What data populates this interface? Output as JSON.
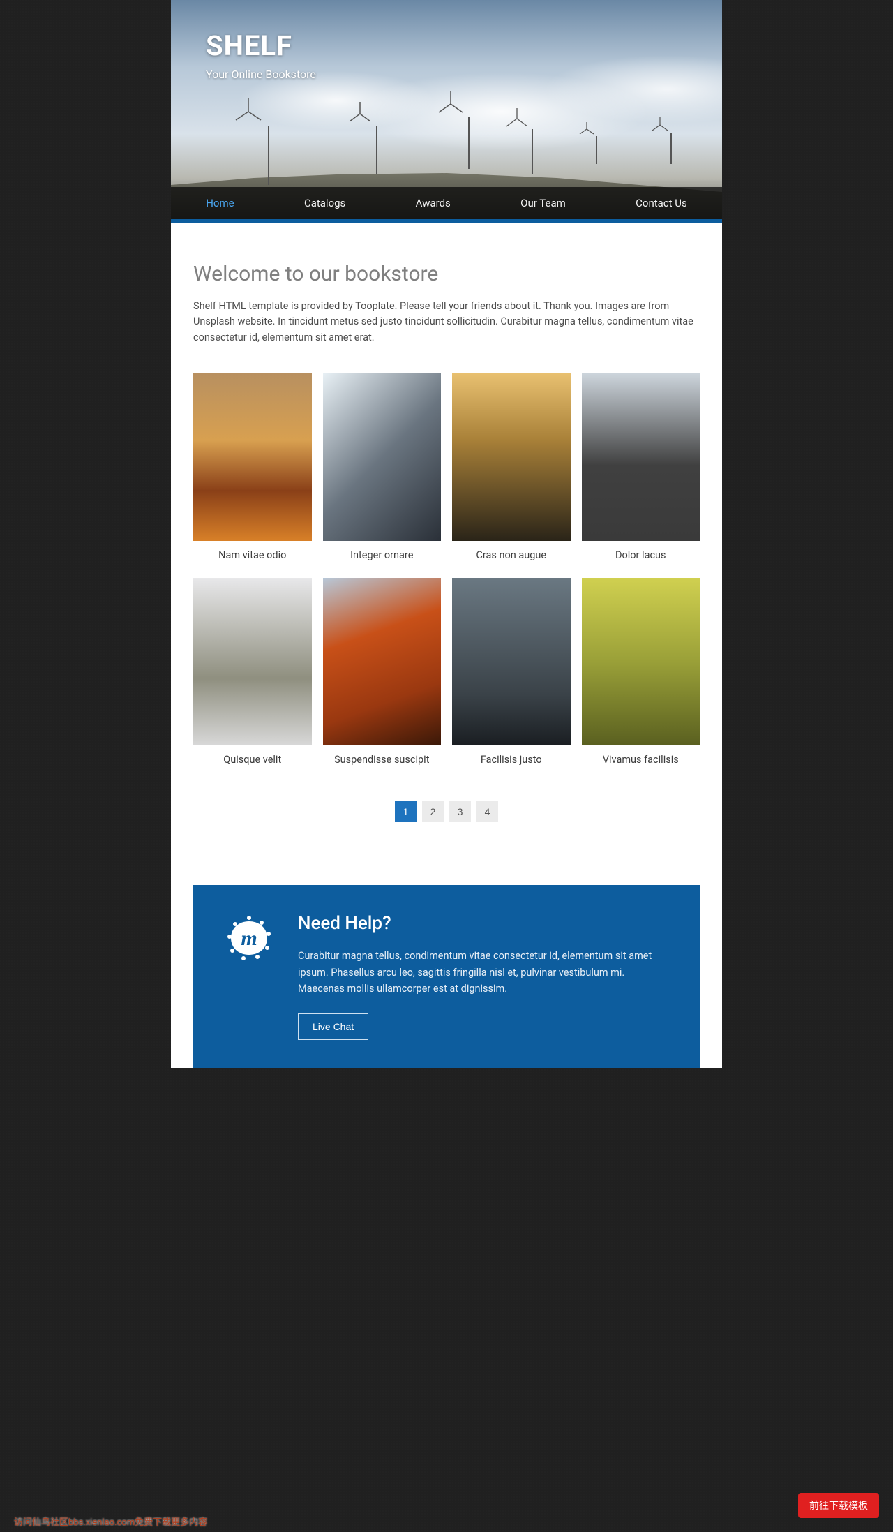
{
  "brand": {
    "title": "SHELF",
    "subtitle": "Your Online Bookstore"
  },
  "nav": {
    "items": [
      {
        "label": "Home",
        "active": true
      },
      {
        "label": "Catalogs",
        "active": false
      },
      {
        "label": "Awards",
        "active": false
      },
      {
        "label": "Our Team",
        "active": false
      },
      {
        "label": "Contact Us",
        "active": false
      }
    ]
  },
  "page": {
    "title": "Welcome to our bookstore",
    "intro": "Shelf HTML template is provided by Tooplate. Please tell your friends about it. Thank you. Images are from Unsplash website. In tincidunt metus sed justo tincidunt sollicitudin. Curabitur magna tellus, condimentum vitae consectetur id, elementum sit amet erat."
  },
  "grid": {
    "items": [
      {
        "caption": "Nam vitae odio"
      },
      {
        "caption": "Integer ornare"
      },
      {
        "caption": "Cras non augue"
      },
      {
        "caption": "Dolor lacus"
      },
      {
        "caption": "Quisque velit"
      },
      {
        "caption": "Suspendisse suscipit"
      },
      {
        "caption": "Facilisis justo"
      },
      {
        "caption": "Vivamus facilisis"
      }
    ]
  },
  "pagination": {
    "pages": [
      "1",
      "2",
      "3",
      "4"
    ],
    "active": "1"
  },
  "help": {
    "title": "Need Help?",
    "body": "Curabitur magna tellus, condimentum vitae consectetur id, elementum sit amet ipsum. Phasellus arcu leo, sagittis fringilla nisl et, pulvinar vestibulum mi. Maecenas mollis ullamcorper est at dignissim.",
    "button": "Live Chat"
  },
  "floating_button": "前往下载模板",
  "footer_line": "访问仙鸟社区bbs.xienlao.com免费下载更多内容"
}
